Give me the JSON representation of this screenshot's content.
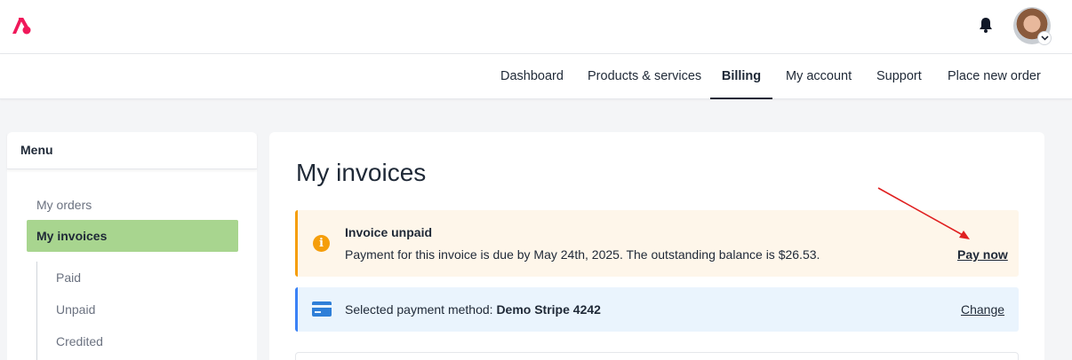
{
  "header": {
    "logo_icon": "brand-logo",
    "bell_icon": "bell-icon",
    "avatar": "user-avatar"
  },
  "nav": {
    "items": [
      {
        "label": "Dashboard"
      },
      {
        "label": "Products & services"
      },
      {
        "label": "Billing",
        "active": true
      },
      {
        "label": "My account"
      },
      {
        "label": "Support"
      },
      {
        "label": "Place new order"
      }
    ]
  },
  "sidebar": {
    "title": "Menu",
    "items": [
      {
        "label": "My orders"
      },
      {
        "label": "My invoices",
        "active": true
      }
    ],
    "subitems": [
      {
        "label": "Paid"
      },
      {
        "label": "Unpaid"
      },
      {
        "label": "Credited"
      }
    ],
    "active_color": "#a8d58f"
  },
  "main": {
    "title": "My invoices",
    "alert": {
      "title": "Invoice unpaid",
      "message": "Payment for this invoice is due by May 24th, 2025. The outstanding balance is $26.53.",
      "action": "Pay now",
      "icon": "info-icon",
      "color": "#f59e0b"
    },
    "payment": {
      "prefix": "Selected payment method: ",
      "method": "Demo Stripe 4242",
      "action": "Change",
      "icon": "credit-card-icon",
      "color": "#3b82f6"
    }
  },
  "annotation": {
    "arrow_color": "#e02020"
  }
}
